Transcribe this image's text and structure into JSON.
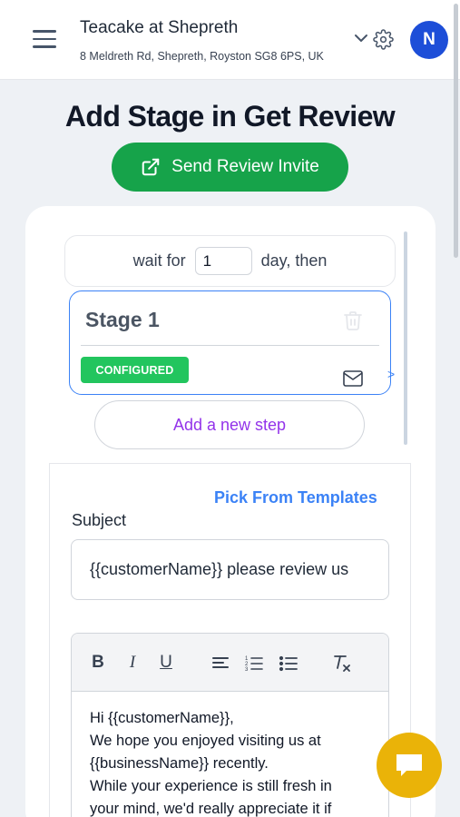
{
  "header": {
    "business_name": "Teacake at Shepreth",
    "business_address": "8 Meldreth Rd, Shepreth, Royston SG8 6PS, UK",
    "avatar_initial": "N"
  },
  "page": {
    "title": "Add Stage in Get Review",
    "send_button_label": "Send Review Invite"
  },
  "stage_flow": {
    "wait_prefix": "wait for",
    "wait_value": "1",
    "wait_suffix": "day, then",
    "stage_title": "Stage 1",
    "stage_status": "CONFIGURED",
    "add_step_label": "Add a new step"
  },
  "editor": {
    "pick_templates_label": "Pick From Templates",
    "subject_label": "Subject",
    "subject_value": "{{customerName}} please review us",
    "toolbar": {
      "bold": "B",
      "italic": "I",
      "underline": "U"
    },
    "body_lines": [
      "Hi {{customerName}},",
      "We hope you enjoyed visiting us at",
      "{{businessName}} recently.",
      "While your experience is still fresh in",
      "your mind, we'd really appreciate it if"
    ]
  },
  "colors": {
    "primary_green": "#16a34a",
    "badge_green": "#22c55e",
    "accent_blue": "#3b82f6",
    "avatar_blue": "#1d4ed8",
    "add_step_purple": "#9333ea",
    "chat_yellow": "#eab308"
  }
}
